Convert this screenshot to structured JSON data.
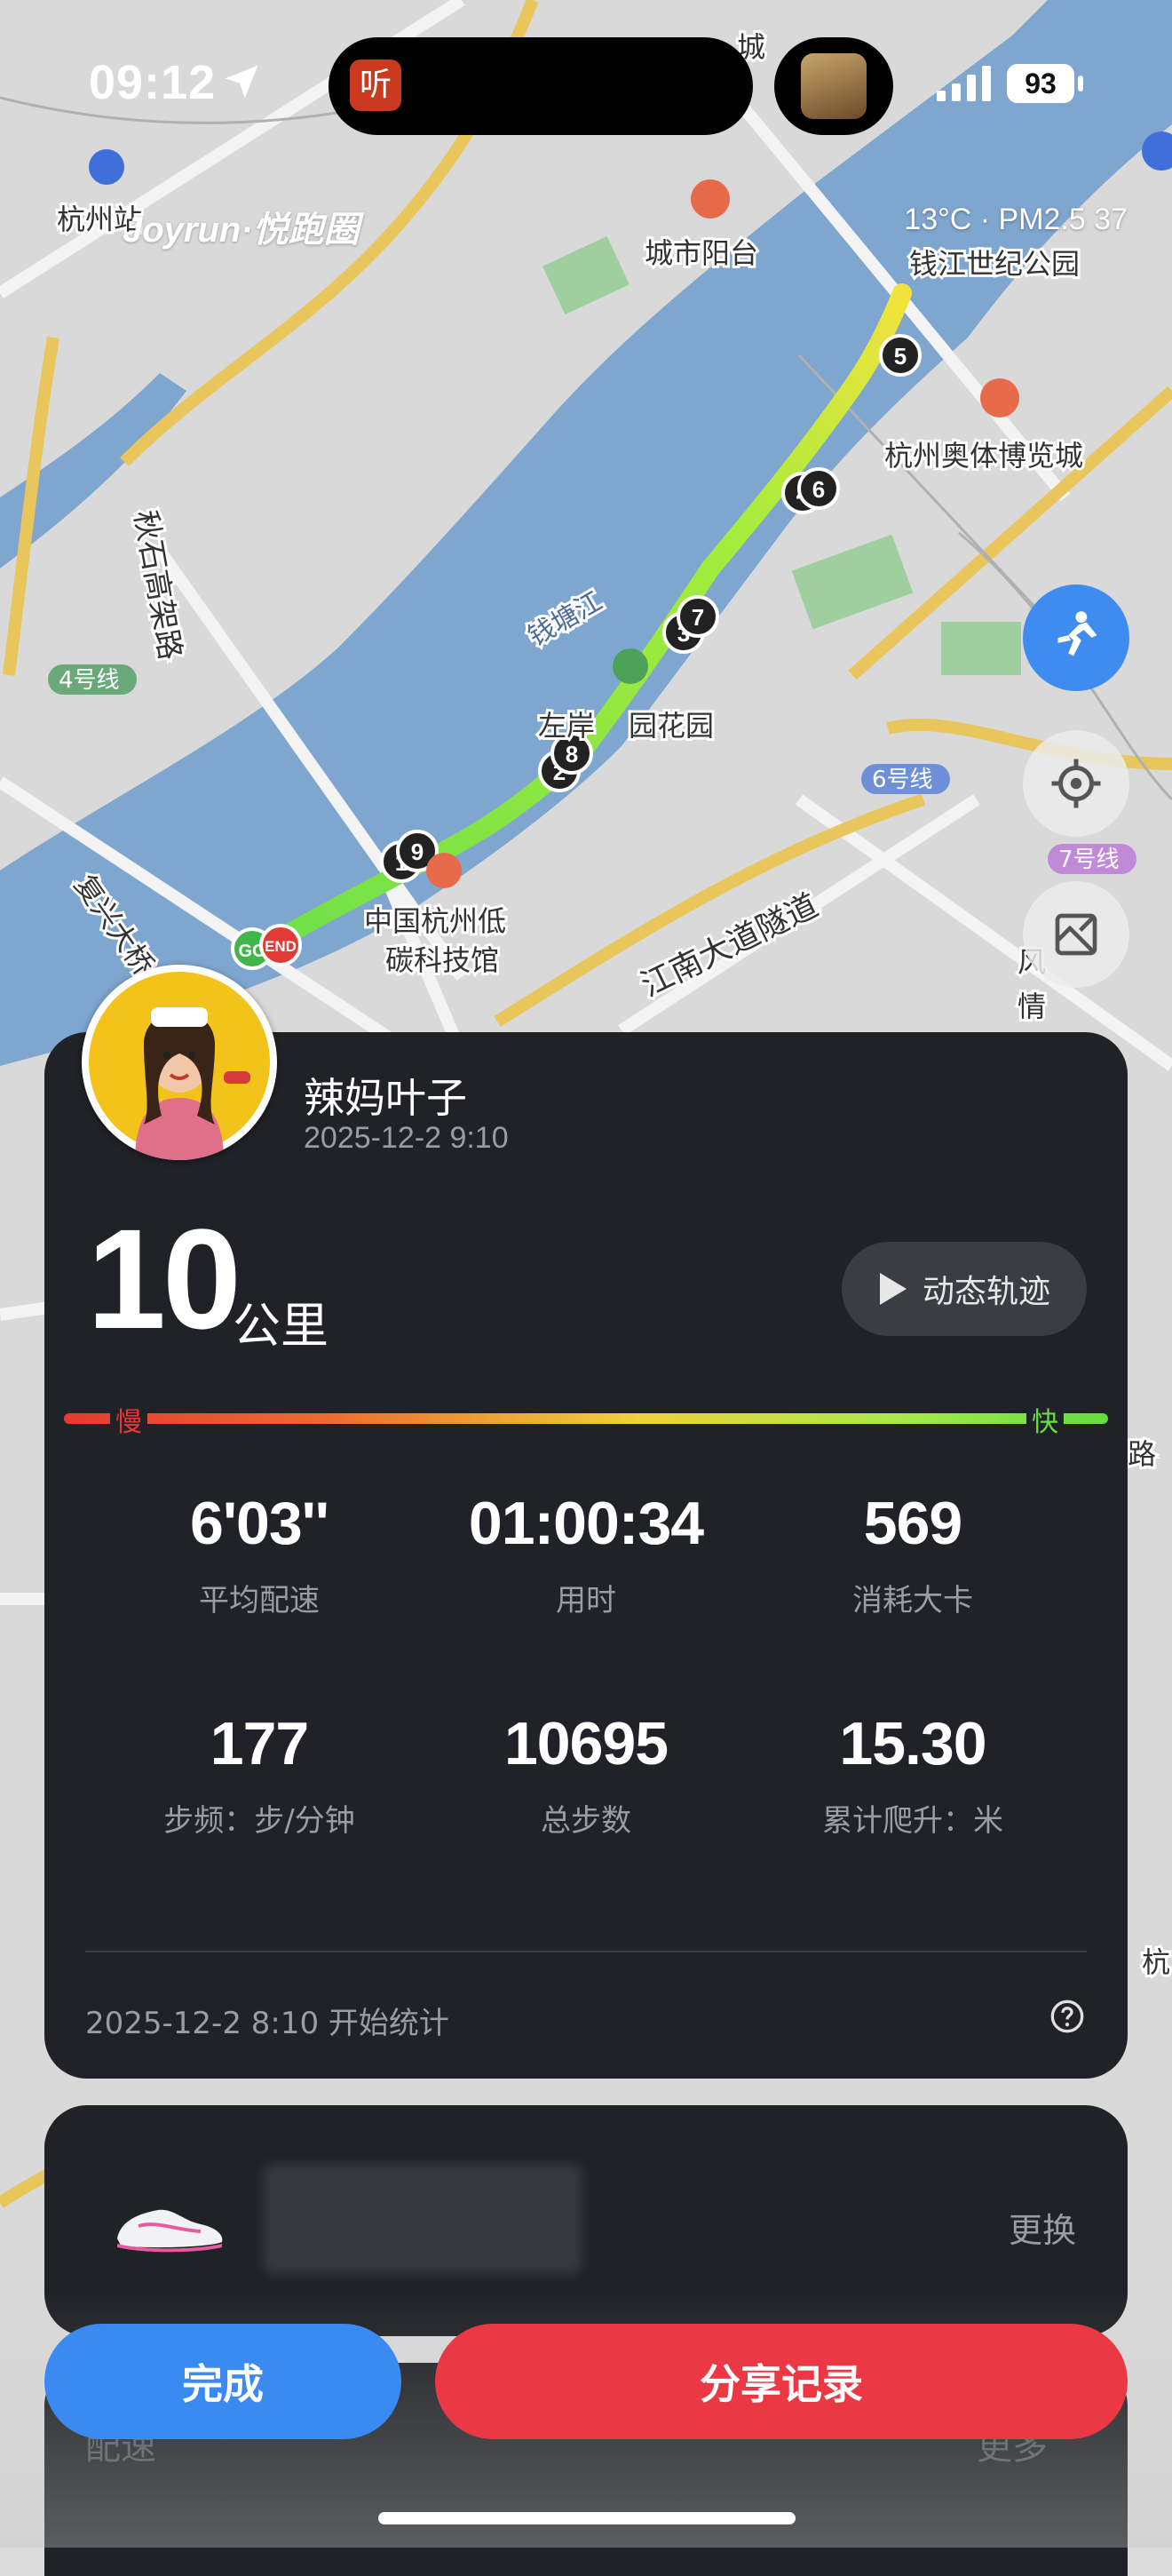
{
  "status_bar": {
    "time": "09:12",
    "island_app_glyph": "听",
    "battery": "93"
  },
  "brand": "Joyrun·悦跑圈",
  "weather": "13°C · PM2.5 37",
  "map": {
    "labels": [
      "杭州站",
      "城市阳台",
      "钱江世纪公园",
      "杭州奥体博览城",
      "秋石高架路",
      "4号线",
      "钱塘江",
      "左岸",
      "园花园",
      "6号线",
      "江南大道隧道",
      "中国杭州低",
      "碳科技馆",
      "复兴大桥",
      "7号线",
      "风",
      "情",
      "路",
      "杭",
      "隧道",
      "城"
    ],
    "markers": [
      "5",
      "6",
      "7",
      "8",
      "9",
      "GO",
      "END",
      "3",
      "2",
      "1",
      "4"
    ]
  },
  "colors": {
    "route_start": "#f2e33c",
    "route_end": "#6fe048",
    "pace_slow": "#e23b36",
    "pace_fast": "#66e040",
    "done_button": "#3a8af2",
    "share_button": "#ea3844",
    "card_bg": "#202227"
  },
  "user": {
    "name": "辣妈叶子",
    "time": "2025-12-2 9:10"
  },
  "distance": {
    "value": "10",
    "unit": "公里"
  },
  "replay_label": "动态轨迹",
  "pace_scale": {
    "slow": "慢",
    "fast": "快"
  },
  "stats": [
    {
      "value": "6'03''",
      "label": "平均配速"
    },
    {
      "value": "01:00:34",
      "label": "用时"
    },
    {
      "value": "569",
      "label": "消耗大卡"
    },
    {
      "value": "177",
      "label": "步频：步/分钟"
    },
    {
      "value": "10695",
      "label": "总步数"
    },
    {
      "value": "15.30",
      "label": "累计爬升：米"
    }
  ],
  "start_stat": "2025-12-2 8:10 开始统计",
  "shoe": {
    "change_label": "更换"
  },
  "ghost": {
    "pace": "配速",
    "more": "更多"
  },
  "buttons": {
    "done": "完成",
    "share": "分享记录"
  },
  "icons": {
    "location_arrow": "location-arrow-icon",
    "signal": "signal-icon",
    "runner": "runner-icon",
    "locate": "locate-icon",
    "map_layer": "map-layer-icon",
    "play": "play-icon",
    "help": "help-icon"
  }
}
